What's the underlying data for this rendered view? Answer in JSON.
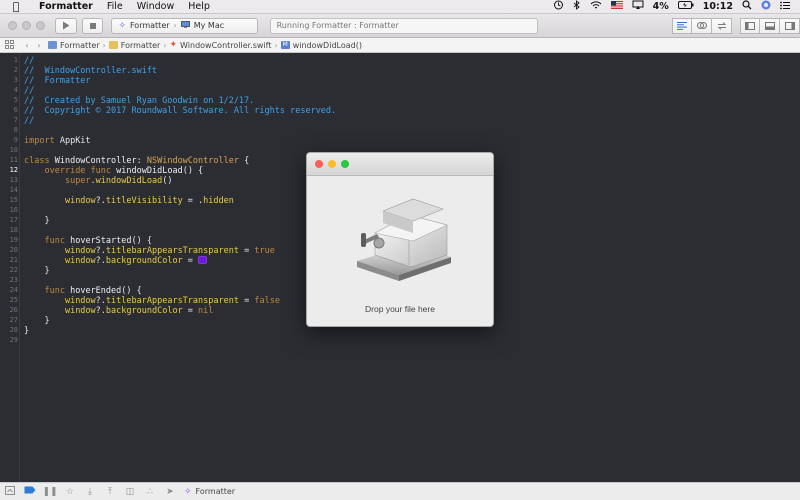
{
  "menubar": {
    "app_name": "Formatter",
    "items": [
      "File",
      "Window",
      "Help"
    ],
    "battery": "4%",
    "time": "10:12"
  },
  "toolbar": {
    "scheme": "Formatter",
    "destination": "My Mac",
    "status": "Running Formatter : Formatter"
  },
  "jumpbar": {
    "crumbs": [
      "Formatter",
      "Formatter",
      "WindowController.swift",
      "windowDidLoad()"
    ]
  },
  "editor": {
    "current_line": 12,
    "line_count": 29,
    "swatch_color": "#6d18d6"
  },
  "bottombar": {
    "target": "Formatter"
  },
  "floating_window": {
    "drop_label": "Drop your file here",
    "close_color": "#fc5f57",
    "minimize_color": "#fdbc2e",
    "zoom_color": "#28c840"
  }
}
